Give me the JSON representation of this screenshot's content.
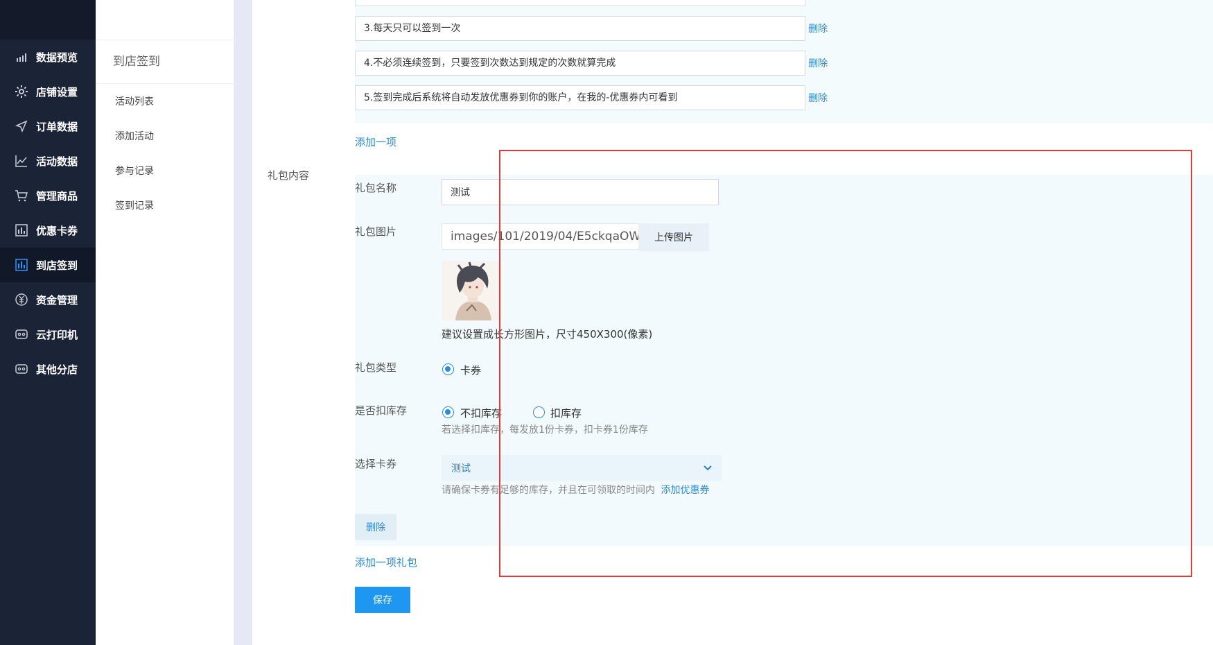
{
  "sidebar": {
    "items": [
      {
        "label": "数据预览",
        "icon": "bar-chart-icon"
      },
      {
        "label": "店铺设置",
        "icon": "gear-icon"
      },
      {
        "label": "订单数据",
        "icon": "send-icon"
      },
      {
        "label": "活动数据",
        "icon": "line-chart-icon"
      },
      {
        "label": "管理商品",
        "icon": "cart-icon"
      },
      {
        "label": "优惠卡券",
        "icon": "coupon-icon"
      },
      {
        "label": "到店签到",
        "icon": "checkin-icon"
      },
      {
        "label": "资金管理",
        "icon": "yen-icon"
      },
      {
        "label": "云打印机",
        "icon": "printer-icon"
      },
      {
        "label": "其他分店",
        "icon": "store-icon"
      }
    ],
    "active_index": 6
  },
  "subnav": {
    "title": "到店签到",
    "items": [
      "活动列表",
      "添加活动",
      "参与记录",
      "签到记录"
    ]
  },
  "rules": {
    "items": [
      "3.每天只可以签到一次",
      "4.不必须连续签到，只要签到次数达到规定的次数就算完成",
      "5.签到完成后系统将自动发放优惠券到你的账户，在我的-优惠券内可看到"
    ],
    "delete_label": "删除",
    "add_label": "添加一项"
  },
  "gift": {
    "section_label": "礼包内容",
    "name_label": "礼包名称",
    "name_value": "测试",
    "image_label": "礼包图片",
    "image_path": "images/101/2019/04/E5ckqaOW",
    "upload_label": "上传图片",
    "image_hint": "建议设置成长方形图片，尺寸450X300(像素)",
    "type_label": "礼包类型",
    "type_option": "卡券",
    "stock_label": "是否扣库存",
    "stock_options": [
      "不扣库存",
      "扣库存"
    ],
    "stock_selected": "不扣库存",
    "stock_hint": "若选择扣库存，每发放1份卡券，扣卡券1份库存",
    "coupon_label": "选择卡券",
    "coupon_value": "测试",
    "coupon_hint": "请确保卡券有足够的库存，并且在可领取的时间内",
    "add_coupon_link": "添加优惠券",
    "delete_button": "删除",
    "add_gift_label": "添加一项礼包"
  },
  "save_label": "保存",
  "colors": {
    "sidebar_bg": "#1b2336",
    "accent": "#2a8cde",
    "save_button": "#1e97f2",
    "highlight_box": "#e53935"
  }
}
